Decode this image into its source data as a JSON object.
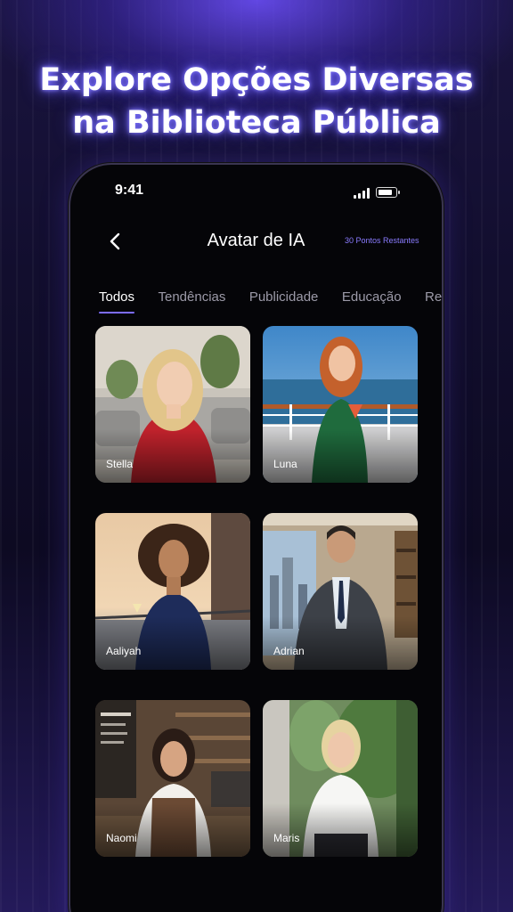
{
  "headline": {
    "line1": "Explore Opções Diversas",
    "line2": "na Biblioteca Pública"
  },
  "status_bar": {
    "time": "9:41"
  },
  "nav": {
    "back_icon": "chevron-left-icon",
    "title": "Avatar de IA",
    "points": "30 Pontos Restantes"
  },
  "tabs": [
    {
      "label": "Todos",
      "active": true
    },
    {
      "label": "Tendências",
      "active": false
    },
    {
      "label": "Publicidade",
      "active": false
    },
    {
      "label": "Educação",
      "active": false
    },
    {
      "label": "Relc",
      "active": false
    }
  ],
  "avatars": [
    {
      "name": "Stella"
    },
    {
      "name": "Luna"
    },
    {
      "name": "Aaliyah"
    },
    {
      "name": "Adrian"
    },
    {
      "name": "Naomi"
    },
    {
      "name": "Maris"
    }
  ],
  "colors": {
    "accent": "#7c6cff",
    "points_text": "#8a7cff",
    "phone_bg": "#050508",
    "tab_inactive": "#9c9aa8"
  }
}
